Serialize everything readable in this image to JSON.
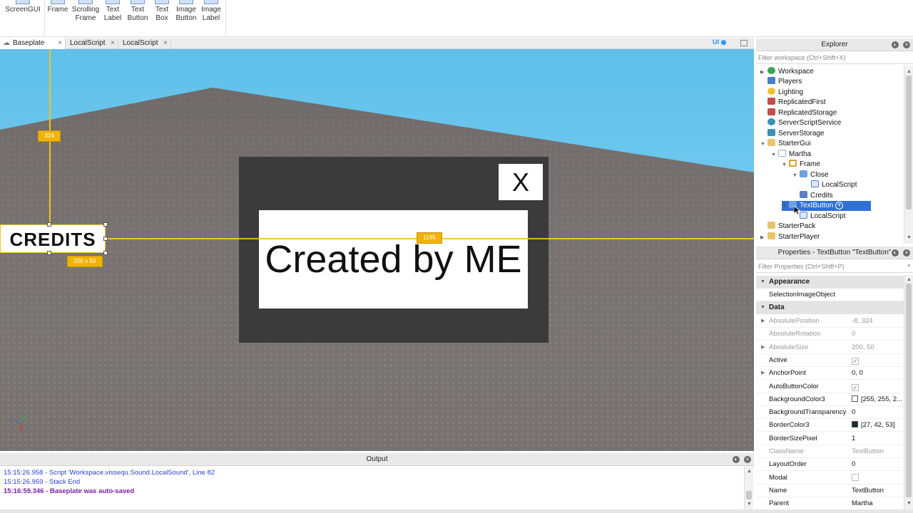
{
  "ribbon": {
    "items": [
      {
        "label1": "ScreenGUI",
        "label2": ""
      },
      {
        "label1": "Frame",
        "label2": ""
      },
      {
        "label1": "Scrolling",
        "label2": "Frame"
      },
      {
        "label1": "Text",
        "label2": "Label"
      },
      {
        "label1": "Text",
        "label2": "Button"
      },
      {
        "label1": "Text",
        "label2": "Box"
      },
      {
        "label1": "Image",
        "label2": "Button"
      },
      {
        "label1": "Image",
        "label2": "Label"
      }
    ]
  },
  "tabs": [
    {
      "label": "Baseplate",
      "close": "×"
    },
    {
      "label": "LocalScript",
      "close": "×"
    },
    {
      "label": "LocalScript",
      "close": "×"
    }
  ],
  "tabbar": {
    "ui_label": "UI"
  },
  "viewport": {
    "guide_top_badge": "324",
    "guide_right_badge": "1195",
    "size_badge": "200 x 50",
    "credits_label": "CREDITS",
    "close_label": "X",
    "created_label": "Created by ME",
    "colors": {
      "sky_top": "#5fc0ea",
      "ground": "#7a7578",
      "frame": "#3b3b3b",
      "guide": "#f0c419"
    }
  },
  "explorer": {
    "title": "Explorer",
    "filter_placeholder": "Filter workspace (Ctrl+Shift+X)",
    "items": [
      {
        "label": "Workspace",
        "arrow": "▶",
        "icon": "workspace-icon",
        "color": "#3aa655"
      },
      {
        "label": "Players",
        "arrow": "",
        "icon": "players-icon",
        "color": "#4a7bd0"
      },
      {
        "label": "Lighting",
        "arrow": "",
        "icon": "lighting-icon",
        "color": "#f2c230"
      },
      {
        "label": "ReplicatedFirst",
        "arrow": "",
        "icon": "replicated-first-icon",
        "color": "#c0504d"
      },
      {
        "label": "ReplicatedStorage",
        "arrow": "",
        "icon": "replicated-storage-icon",
        "color": "#c0504d"
      },
      {
        "label": "ServerScriptService",
        "arrow": "",
        "icon": "server-script-service-icon",
        "color": "#3a8fb7"
      },
      {
        "label": "ServerStorage",
        "arrow": "",
        "icon": "server-storage-icon",
        "color": "#3a8fb7"
      },
      {
        "label": "StarterGui",
        "arrow": "▼",
        "icon": "starter-gui-icon",
        "color": "#e8c56b"
      },
      {
        "label": "Martha",
        "arrow": "▼",
        "icon": "screengui-icon",
        "color": "#8fb5e0"
      },
      {
        "label": "Frame",
        "arrow": "▼",
        "icon": "frame-icon",
        "color": "#e39b2e"
      },
      {
        "label": "Close",
        "arrow": "▼",
        "icon": "textbutton-icon",
        "color": "#6fa1e0"
      },
      {
        "label": "LocalScript",
        "arrow": "",
        "icon": "localscript-icon",
        "color": "#5b7fc7"
      },
      {
        "label": "Credits",
        "arrow": "",
        "icon": "credits-script-icon",
        "color": "#5b7fc7"
      },
      {
        "label": "TextButton",
        "arrow": "▼",
        "icon": "textbutton-icon",
        "color": "#6fa1e0"
      },
      {
        "label": "LocalScript",
        "arrow": "",
        "icon": "localscript-icon",
        "color": "#5b7fc7"
      },
      {
        "label": "StarterPack",
        "arrow": "",
        "icon": "starter-pack-icon",
        "color": "#e8c56b"
      },
      {
        "label": "StarterPlayer",
        "arrow": "▶",
        "icon": "starter-player-icon",
        "color": "#e8c56b"
      }
    ]
  },
  "properties": {
    "title": "Properties - TextButton \"TextButton\"",
    "filter_placeholder": "Filter Properties (Ctrl+Shift+P)",
    "appearance_label": "Appearance",
    "selection_image_label": "SelectionImageObject",
    "data_label": "Data",
    "rows": [
      {
        "name": "AbsolutePosition",
        "value": "-8, 324",
        "arrow": "▶",
        "dim": true
      },
      {
        "name": "AbsoluteRotation",
        "value": "0",
        "arrow": "",
        "dim": true
      },
      {
        "name": "AbsoluteSize",
        "value": "200, 50",
        "arrow": "▶",
        "dim": true
      },
      {
        "name": "Active",
        "value": "",
        "arrow": "",
        "check": "✓"
      },
      {
        "name": "AnchorPoint",
        "value": "0, 0",
        "arrow": "▶"
      },
      {
        "name": "AutoButtonColor",
        "value": "",
        "arrow": "",
        "check": "✓"
      },
      {
        "name": "BackgroundColor3",
        "value": "[255, 255, 2...",
        "arrow": "",
        "swatch": "#ffffff"
      },
      {
        "name": "BackgroundTransparency",
        "value": "0",
        "arrow": ""
      },
      {
        "name": "BorderColor3",
        "value": "[27, 42, 53]",
        "arrow": "",
        "swatch": "#1b2a35"
      },
      {
        "name": "BorderSizePixel",
        "value": "1",
        "arrow": ""
      },
      {
        "name": "ClassName",
        "value": "TextButton",
        "arrow": "",
        "dim": true
      },
      {
        "name": "LayoutOrder",
        "value": "0",
        "arrow": ""
      },
      {
        "name": "Modal",
        "value": "",
        "arrow": "",
        "check": ""
      },
      {
        "name": "Name",
        "value": "TextButton",
        "arrow": ""
      },
      {
        "name": "Parent",
        "value": "Martha",
        "arrow": ""
      }
    ]
  },
  "output": {
    "title": "Output",
    "lines": [
      {
        "text": "15:15:26.958 - Script 'Workspace.vissequ.Sound.LocalSound', Line 82",
        "color": "#2a3fd0",
        "bold": false
      },
      {
        "text": "15:15:26.959 - Stack End",
        "color": "#2a3fd0",
        "bold": false
      },
      {
        "text": "15:16:59.346 - Baseplate was auto-saved",
        "color": "#7a1fa2",
        "bold": true
      }
    ]
  }
}
